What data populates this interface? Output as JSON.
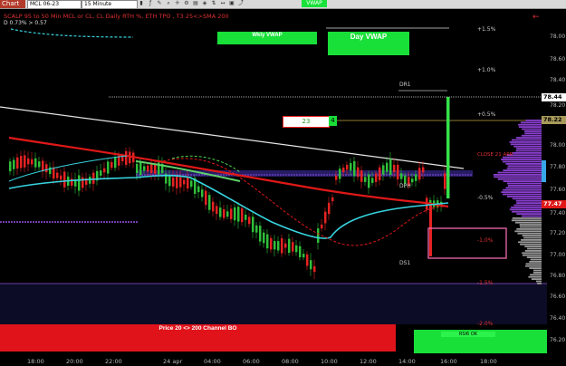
{
  "toolbar": {
    "chart_tab": "Chart",
    "instrument": "MCL 06-23",
    "interval": "15 Minute",
    "vwap_button": "VWAP"
  },
  "header": {
    "indicator_line": "SCALP 95 to 50 Min MCL or CL, CL Daily RTH %, ETH TPO , T3 25<>SMA 200",
    "sub_line": "D 0.73% > 0.57"
  },
  "boxes": {
    "wkly_vwap": "Wkly VWAP",
    "day_vwap": "Day VWAP",
    "channel_bo": "Price 20 <> 200 Channel BO",
    "input_value": "23",
    "input_badge": "4",
    "green_bar_label": "RSI6 OK"
  },
  "levels": {
    "dr1": "DR1",
    "dph": "DPH",
    "ds1": "DS1",
    "close_label": "CLOSE 21 APR"
  },
  "pct_labels": [
    "+1.5%",
    "+1.0%",
    "+0.5%",
    "-0.5%",
    "-1.0%",
    "-1.5%",
    "-2.0%"
  ],
  "price_axis": [
    "78.00",
    "78.60",
    "78.40",
    "78.20",
    "78.00",
    "77.80",
    "77.60",
    "77.40",
    "77.20",
    "77.00",
    "76.80",
    "76.60",
    "76.40",
    "76.20"
  ],
  "price_tags": {
    "last": "78.44",
    "mid": "78.22",
    "red": "77.47"
  },
  "time_axis": [
    "18:00",
    "20:00",
    "22:00",
    "24 apr",
    "04:00",
    "06:00",
    "08:00",
    "10:00",
    "12:00",
    "14:00",
    "16:00",
    "18:00"
  ],
  "colors": {
    "bull": "#2fbf3a",
    "bear": "#e52222",
    "vwap_box": "#1de03a",
    "channel_bar": "#e0131b",
    "profile": "#8a3fd0",
    "cyan": "#37d5e0"
  }
}
